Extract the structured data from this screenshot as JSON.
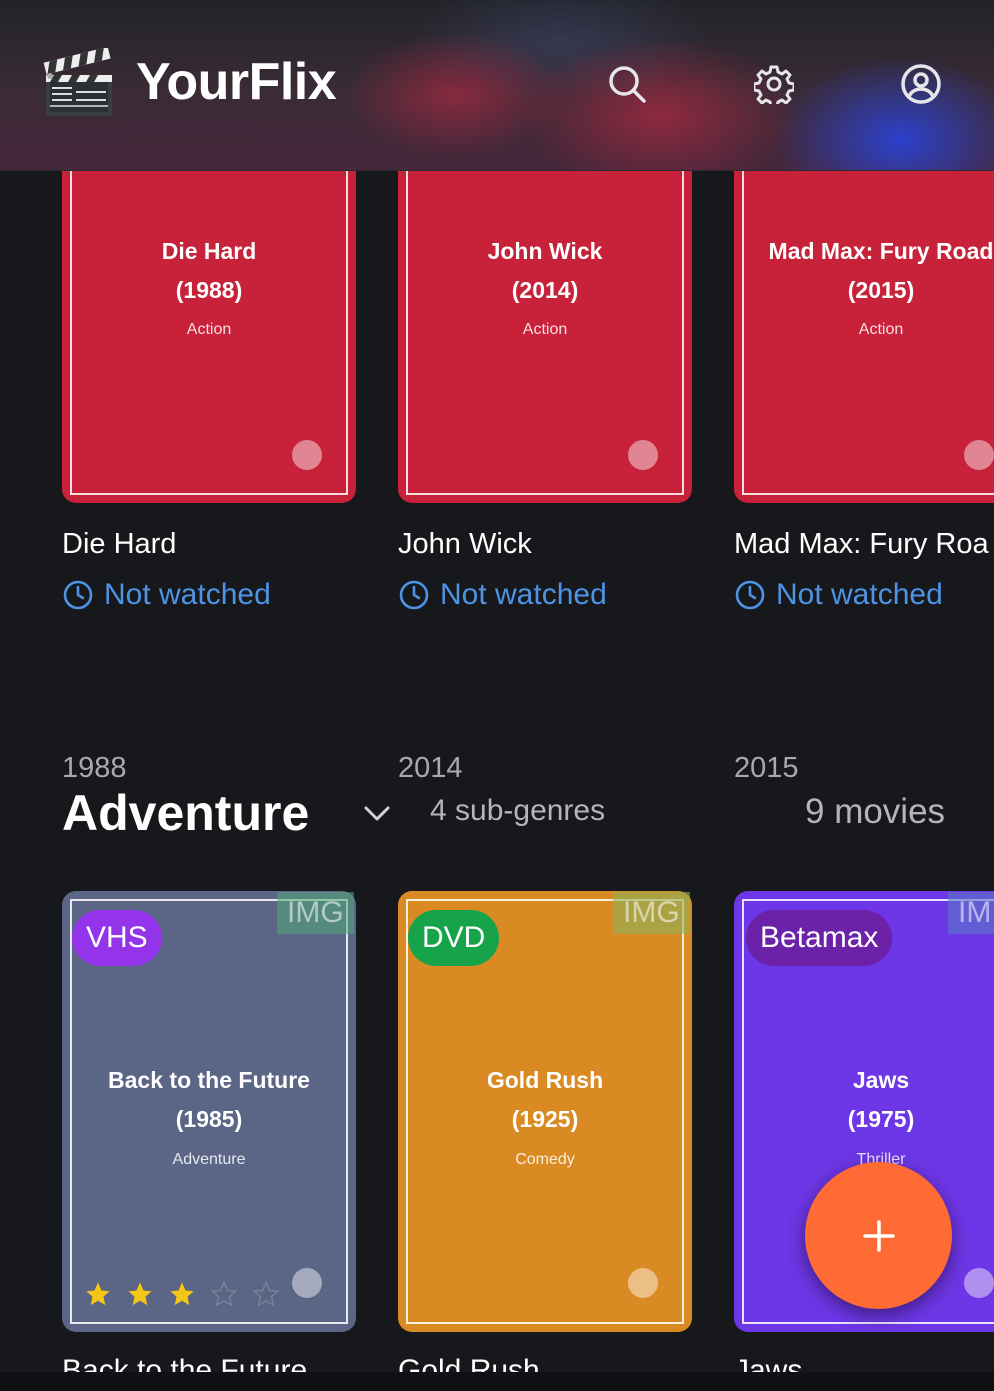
{
  "app": {
    "name": "YourFlix"
  },
  "header": {
    "logo_icon": "clapperboard-icon",
    "search_icon": "search-icon",
    "settings_icon": "gear-icon",
    "profile_icon": "user-circle-icon"
  },
  "action_movies": [
    {
      "title": "Die Hard",
      "year": "1988",
      "poster_year": "(1988)",
      "genre": "Action",
      "status": "Not watched",
      "color": "#c8213a"
    },
    {
      "title": "John Wick",
      "year": "2014",
      "poster_year": "(2014)",
      "genre": "Action",
      "status": "Not watched",
      "color": "#c8213a"
    },
    {
      "title": "Mad Max: Fury Road",
      "card_title": "Mad Max: Fury Roa",
      "year": "2015",
      "poster_year": "(2015)",
      "genre": "Action",
      "status": "Not watched",
      "color": "#c8213a"
    }
  ],
  "adventure": {
    "title": "Adventure",
    "subgenres": "4 sub-genres",
    "count": "9 movies",
    "movies": [
      {
        "title": "Back to the Future",
        "poster_year": "(1985)",
        "genre": "Adventure",
        "format": "VHS",
        "format_color": "#9333ea",
        "img_tag": "IMG",
        "color": "#5b6585",
        "rating": 3,
        "rating_max": 5,
        "cut_title": "Back to the Future"
      },
      {
        "title": "Gold Rush",
        "poster_year": "(1925)",
        "genre": "Comedy",
        "format": "DVD",
        "format_color": "#16a34a",
        "img_tag": "IMG",
        "color": "#da8a22",
        "cut_title": "Gold Rush"
      },
      {
        "title": "Jaws",
        "poster_year": "(1975)",
        "genre": "Thriller",
        "format": "Betamax",
        "format_color": "#6b21a8",
        "img_tag": "IM",
        "color": "#6d36e6",
        "cut_title": "Jaws"
      }
    ]
  },
  "fab": {
    "label": "+"
  }
}
